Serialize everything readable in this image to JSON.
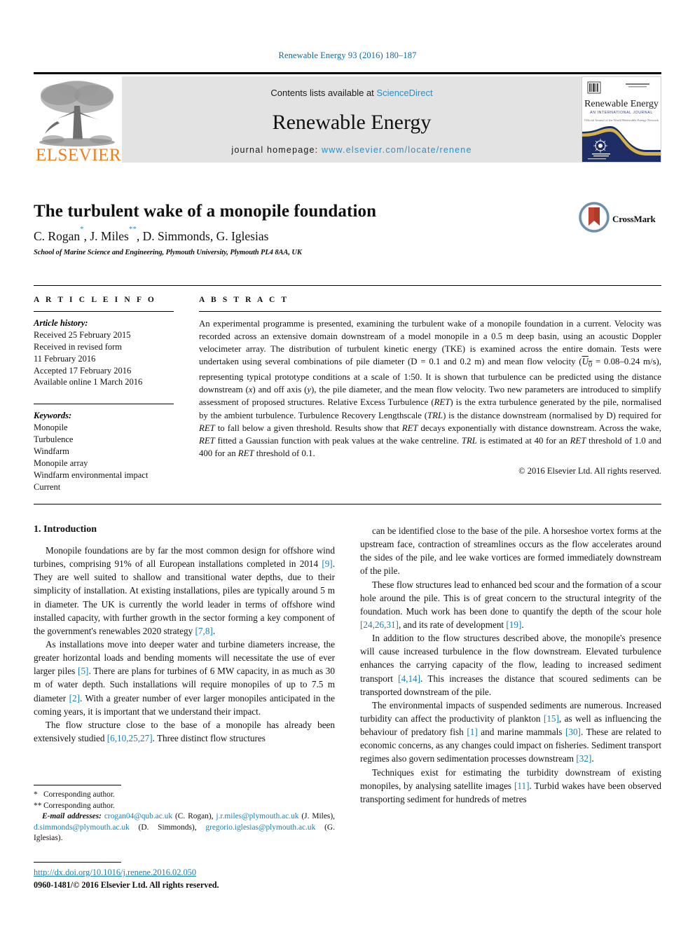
{
  "running_head": "Renewable Energy 93 (2016) 180–187",
  "masthead": {
    "publisher_name": "ELSEVIER",
    "contents_prefix": "Contents lists available at ",
    "contents_link": "ScienceDirect",
    "journal_title": "Renewable Energy",
    "homepage_prefix": "journal homepage: ",
    "homepage_url": "www.elsevier.com/locate/renene",
    "cover": {
      "title": "Renewable Energy",
      "subtitle": "AN INTERNATIONAL JOURNAL",
      "tagline": "Official Journal of the World Renewable Energy Network"
    },
    "link_color": "#2b8fc4",
    "band_color": "#e3e3e3",
    "elsevier_orange": "#ef7d1a"
  },
  "article": {
    "title": "The turbulent wake of a monopile foundation",
    "authors_html": "C. Rogan<sup>*</sup>, J. Miles<sup>**</sup>, D. Simmonds, G. Iglesias",
    "affiliation": "School of Marine Science and Engineering, Plymouth University, Plymouth PL4 8AA, UK",
    "crossmark_label": "CrossMark"
  },
  "article_info": {
    "heading": "A R T I C L E   I N F O",
    "history_label": "Article history:",
    "history": [
      "Received 25 February 2015",
      "Received in revised form",
      "11 February 2016",
      "Accepted 17 February 2016",
      "Available online 1 March 2016"
    ],
    "keywords_label": "Keywords:",
    "keywords": [
      "Monopile",
      "Turbulence",
      "Windfarm",
      "Monopile array",
      "Windfarm environmental impact",
      "Current"
    ]
  },
  "abstract": {
    "heading": "A B S T R A C T",
    "body_html": "An experimental programme is presented, examining the turbulent wake of a monopile foundation in a current. Velocity was recorded across an extensive domain downstream of a model monopile in a 0.5 m deep basin, using an acoustic Doppler velocimeter array. The distribution of turbulent kinetic energy (TKE) is examined across the entire domain. Tests were undertaken using several combinations of pile diameter (D = 0.1 and 0.2 m) and mean flow velocity (<span style=\"text-decoration:overline\"><i>U</i><sub>0</sub></span> = 0.08–0.24 m/s), representing typical prototype conditions at a scale of 1:50. It is shown that turbulence can be predicted using the distance downstream (<i>x</i>) and off axis (<i>y</i>), the pile diameter, and the mean flow velocity. Two new parameters are introduced to simplify assessment of proposed structures. Relative Excess Turbulence (<i>RET</i>) is the extra turbulence generated by the pile, normalised by the ambient turbulence. Turbulence Recovery Lengthscale (<i>TRL</i>) is the distance downstream (normalised by D) required for <i>RET</i> to fall below a given threshold. Results show that <i>RET</i> decays exponentially with distance downstream. Across the wake, <i>RET</i> fitted a Gaussian function with peak values at the wake centreline. <i>TRL</i> is estimated at 40 for an <i>RET</i> threshold of 1.0 and 400 for an <i>RET</i> threshold of 0.1.",
    "copyright": "© 2016 Elsevier Ltd. All rights reserved."
  },
  "body": {
    "section_number_title": "1.  Introduction",
    "left_paragraphs_html": [
      "Monopile foundations are by far the most common design for offshore wind turbines, comprising 91% of all European installations completed in 2014 <span class=\"ref\">[9]</span>. They are well suited to shallow and transitional water depths, due to their simplicity of installation. At existing installations, piles are typically around 5 m in diameter. The UK is currently the world leader in terms of offshore wind installed capacity, with further growth in the sector forming a key component of the government's renewables 2020 strategy <span class=\"ref\">[7,8]</span>.",
      "As installations move into deeper water and turbine diameters increase, the greater horizontal loads and bending moments will necessitate the use of ever larger piles <span class=\"ref\">[5]</span>. There are plans for turbines of 6 MW capacity, in as much as 30 m of water depth. Such installations will require monopiles of up to 7.5 m diameter <span class=\"ref\">[2]</span>. With a greater number of ever larger monopiles anticipated in the coming years, it is important that we understand their impact.",
      "The flow structure close to the base of a monopile has already been extensively studied <span class=\"ref\">[6,10,25,27]</span>. Three distinct flow structures"
    ],
    "right_paragraphs_html": [
      "can be identified close to the base of the pile. A horseshoe vortex forms at the upstream face, contraction of streamlines occurs as the flow accelerates around the sides of the pile, and lee wake vortices are formed immediately downstream of the pile.",
      "These flow structures lead to enhanced bed scour and the formation of a scour hole around the pile. This is of great concern to the structural integrity of the foundation. Much work has been done to quantify the depth of the scour hole <span class=\"ref\">[24,26,31]</span>, and its rate of development <span class=\"ref\">[19]</span>.",
      "In addition to the flow structures described above, the monopile's presence will cause increased turbulence in the flow downstream. Elevated turbulence enhances the carrying capacity of the flow, leading to increased sediment transport <span class=\"ref\">[4,14]</span>. This increases the distance that scoured sediments can be transported downstream of the pile.",
      "The environmental impacts of suspended sediments are numerous. Increased turbidity can affect the productivity of plankton <span class=\"ref\">[15]</span>, as well as influencing the behaviour of predatory fish <span class=\"ref\">[1]</span> and marine mammals <span class=\"ref\">[30]</span>. These are related to economic concerns, as any changes could impact on fisheries. Sediment transport regimes also govern sedimentation processes downstream <span class=\"ref\">[32]</span>.",
      "Techniques exist for estimating the turbidity downstream of existing monopiles, by analysing satellite images <span class=\"ref\">[11]</span>. Turbid wakes have been observed transporting sediment for hundreds of metres"
    ]
  },
  "footnotes": {
    "corresponding_1_mark": "*",
    "corresponding_1": "Corresponding author.",
    "corresponding_2_mark": "**",
    "corresponding_2": "Corresponding author.",
    "email_label": "E-mail addresses:",
    "emails_html": "<span class=\"mail\">crogan04@qub.ac.uk</span> (C. Rogan), <span class=\"mail\">j.r.miles@plymouth.ac.uk</span> (J. Miles), <span class=\"mail\">d.simmonds@plymouth.ac.uk</span> (D. Simmonds), <span class=\"mail\">gregorio.iglesias@plymouth.ac.uk</span> (G. Iglesias).",
    "doi": "http://dx.doi.org/10.1016/j.renene.2016.02.050",
    "issn_line": "0960-1481/© 2016 Elsevier Ltd. All rights reserved."
  }
}
